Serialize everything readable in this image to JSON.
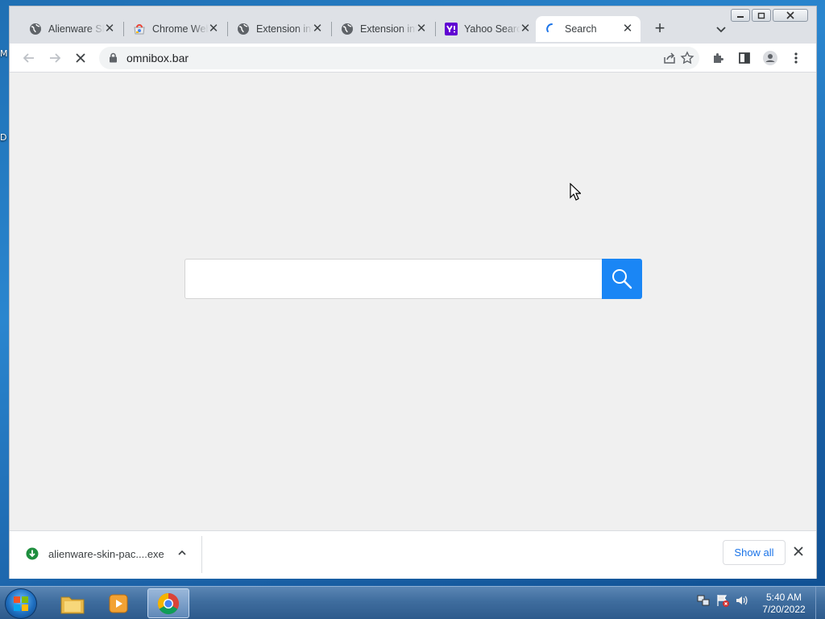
{
  "desktop": {
    "icon_labels": [
      "M",
      "D"
    ]
  },
  "tabs": [
    {
      "title": "Alienware Skin",
      "favicon": "globe-icon",
      "active": false
    },
    {
      "title": "Chrome Web Store",
      "favicon": "chrome-web-store-icon",
      "active": false
    },
    {
      "title": "Extension info",
      "favicon": "globe-icon",
      "active": false
    },
    {
      "title": "Extension info",
      "favicon": "globe-icon",
      "active": false
    },
    {
      "title": "Yahoo Search",
      "favicon": "yahoo-icon",
      "active": false
    },
    {
      "title": "Search",
      "favicon": "loading-spinner-icon",
      "active": true
    }
  ],
  "toolbar": {
    "url": "omnibox.bar"
  },
  "page": {
    "search_placeholder": ""
  },
  "downloads": {
    "file_name": "alienware-skin-pac....exe",
    "show_all_label": "Show all"
  },
  "taskbar": {
    "apps": [
      "file-explorer-icon",
      "media-player-icon",
      "chrome-icon"
    ],
    "time": "5:40 AM",
    "date": "7/20/2022"
  },
  "colors": {
    "accent": "#1a86f5",
    "yahoo": "#6001d2",
    "download_ok": "#1e8e3e"
  }
}
